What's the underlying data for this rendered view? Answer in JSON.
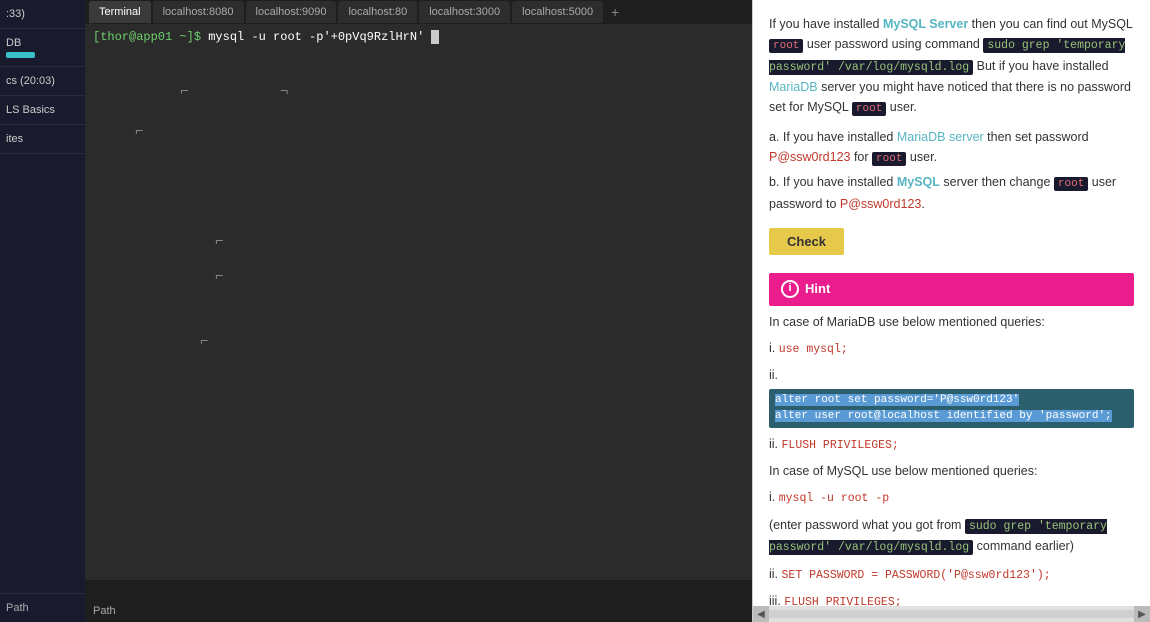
{
  "sidebar": {
    "items": [
      {
        "label": ":33)",
        "active": false
      },
      {
        "label": "DB",
        "active": false,
        "progress": 40
      },
      {
        "label": "cs (20:03)",
        "active": false
      },
      {
        "label": "LS Basics",
        "active": false
      },
      {
        "label": "ites",
        "active": false
      }
    ],
    "footer_label": "Path"
  },
  "tabs": [
    {
      "label": "Terminal",
      "active": true
    },
    {
      "label": "localhost:8080",
      "active": false
    },
    {
      "label": "localhost:9090",
      "active": false
    },
    {
      "label": "localhost:80",
      "active": false
    },
    {
      "label": "localhost:3000",
      "active": false
    },
    {
      "label": "localhost:5000",
      "active": false
    }
  ],
  "tab_add_label": "+",
  "terminal": {
    "prompt": "[thor@app01 ~]$",
    "command": " mysql -u root -p'+0pVq9RzlHrN'",
    "brackets": [
      "⌐",
      "¬",
      "⌐",
      "¬",
      "⌐",
      "⌐",
      "⌐",
      "¬"
    ]
  },
  "right_panel": {
    "intro_text": "If you have installed ",
    "mysql_server": "MySQL Server",
    "intro_text2": " then you can find out MySQL ",
    "root1": "root",
    "intro_text3": " user password using command ",
    "cmd_grep": "sudo grep 'temporary password' /var/log/mysqld.log",
    "intro_text4": " But if you have installed ",
    "mariadb1": "MariaDB",
    "intro_text5": " server you might have noticed that there is no password set for MySQL ",
    "root2": "root",
    "intro_text6": " user.",
    "part_a": "a. If you have installed ",
    "mariadb_server": "MariaDB server",
    "part_a2": " then set password ",
    "password1": "P@ssw0rd123",
    "part_a3": " for ",
    "root3": "root",
    "part_a4": " user.",
    "part_b": "b. If you have installed ",
    "mysql2": "MySQL",
    "part_b2": " server then change ",
    "root4": "root",
    "part_b3": " user password to ",
    "password2": "P@ssw0rd123",
    "part_b4": ".",
    "check_label": "Check",
    "hint_label": "Hint",
    "hint_intro": "In case of MariaDB use below mentioned queries:",
    "hint_i": "i.",
    "hint_use_mysql": "use mysql;",
    "hint_ii": "ii.",
    "hint_cmd_ii_line1": "alter root set password='P@ssw0rd123'",
    "hint_cmd_ii_line2": "alter user root@localhost identified by 'password';",
    "hint_iii": "ii.",
    "hint_flush": "FLUSH PRIVILEGES;",
    "hint_mysql_intro": "In case of MySQL use below mentioned queries:",
    "hint_mysql_i": "i.",
    "hint_mysql_cmd": "mysql -u root -p",
    "hint_enter_pw": "(enter password what you got from ",
    "hint_grep_cmd": "sudo grep 'temporary password' /var/log/mysqld.log",
    "hint_enter_pw2": " command earlier)",
    "hint_mysql_ii": "ii.",
    "hint_set_pw": "SET PASSWORD = PASSWORD('P@ssw0rd123');",
    "hint_mysql_iii": "iii.",
    "hint_flush2": "FLUSH PRIVILEGES;"
  },
  "bottom": {
    "path_label": "Path"
  }
}
